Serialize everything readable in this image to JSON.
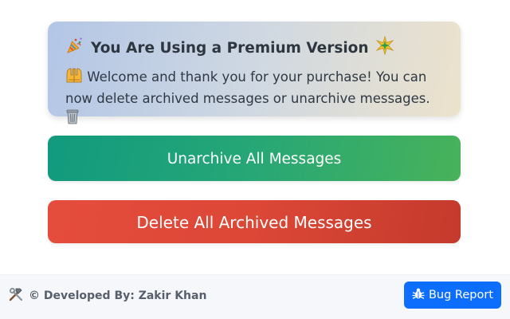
{
  "premium": {
    "title": "You Are Using a Premium Version",
    "title_icon_left": "party-popper-icon",
    "title_icon_right": "sparkle-star-icon",
    "body_icon": "raising-hands-icon",
    "body": "Welcome and thank you for your purchase! You can now delete archived messages or unarchive messages.",
    "body_end_icon": "wastebasket-icon"
  },
  "actions": {
    "unarchive_label": "Unarchive All Messages",
    "delete_label": "Delete All Archived Messages"
  },
  "footer": {
    "credit_icon": "hammer-wrench-icon",
    "credit": "© Developed By: Zakir Khan",
    "bug_icon": "bug-icon",
    "bug_label": "Bug Report"
  },
  "colors": {
    "unarchive_start": "#119a7e",
    "unarchive_end": "#48b25a",
    "delete_start": "#e54c3c",
    "delete_end": "#c43a2c",
    "bug_button": "#0d6efd"
  }
}
